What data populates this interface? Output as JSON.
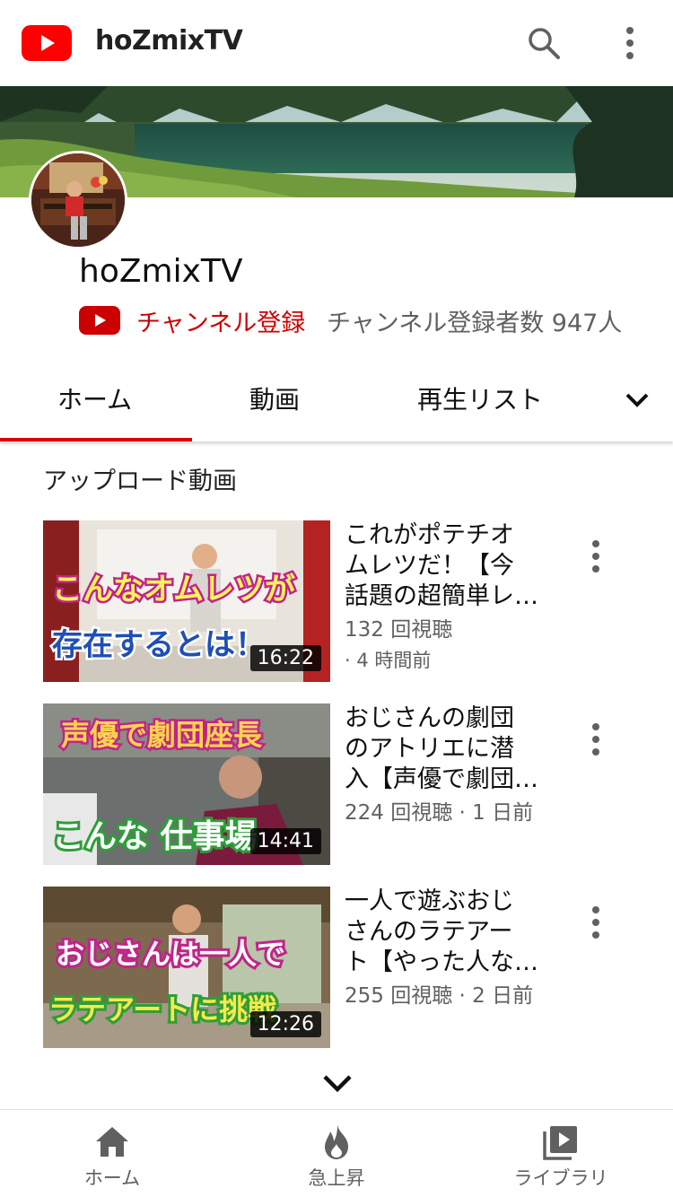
{
  "header": {
    "app_title": "hoZmixTV",
    "icons": [
      "youtube-logo",
      "search-icon",
      "more-vert-icon"
    ]
  },
  "channel": {
    "name": "hoZmixTV",
    "subscribe_label": "チャンネル登録",
    "subscriber_count": "チャンネル登録者数 947人"
  },
  "tabs": {
    "items": [
      {
        "label": "ホーム",
        "selected": true
      },
      {
        "label": "動画",
        "selected": false
      },
      {
        "label": "再生リスト",
        "selected": false
      }
    ]
  },
  "section": {
    "title": "アップロード動画"
  },
  "videos": [
    {
      "title": "これがポテチオムレツだ！【今話題の超簡単レ…",
      "title_lines": [
        "これがポテチオ",
        "ムレツだ！【今",
        "話題の超簡単レ…"
      ],
      "views": "132 回視聴",
      "age": "· 4 時間前",
      "duration": "16:22",
      "thumb_text": [
        "こんなオムレツが",
        "存在するとは！"
      ]
    },
    {
      "title": "おじさんの劇団のアトリエに潜入【声優で劇団…",
      "title_lines": [
        "おじさんの劇団",
        "のアトリエに潜",
        "入【声優で劇団…"
      ],
      "meta": "224 回視聴 · 1 日前",
      "duration": "14:41",
      "thumb_text": [
        "声優で劇団座長",
        "こんな 仕事場"
      ]
    },
    {
      "title": "一人で遊ぶおじさんのラテアート【やった人な…",
      "title_lines": [
        "一人で遊ぶおじ",
        "さんのラテアー",
        "ト【やった人な…"
      ],
      "meta": "255 回視聴 · 2 日前",
      "duration": "12:26",
      "thumb_text": [
        "おじさんは一人で",
        "ラテアートに挑戦"
      ]
    }
  ],
  "bottom_nav": {
    "items": [
      {
        "label": "ホーム",
        "icon": "home-icon"
      },
      {
        "label": "急上昇",
        "icon": "trending-icon"
      },
      {
        "label": "ライブラリ",
        "icon": "library-icon"
      }
    ]
  },
  "colors": {
    "brand_red": "#ff0000",
    "subscribe_red": "#cc0000",
    "tab_indicator": "#e00000",
    "secondary_text": "#606060"
  }
}
